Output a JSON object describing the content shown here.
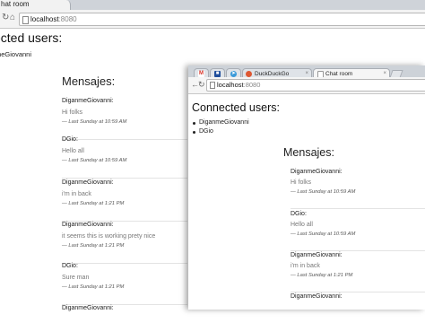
{
  "back_window": {
    "tab_title": "hat room",
    "url_host": "localhost",
    "url_port": ":8080",
    "heading": "ected users:",
    "users": [
      "meGiovanni"
    ],
    "chat_title": "Mensajes:",
    "messages": [
      {
        "author": "DiganmeGiovanni:",
        "text": "Hi folks",
        "time": "— Last Sunday at 10:59 AM"
      },
      {
        "author": "DGio:",
        "text": "Hello all",
        "time": "— Last Sunday at 10:59 AM"
      },
      {
        "author": "DiganmeGiovanni:",
        "text": "i'm in back",
        "time": "— Last Sunday at 1:21 PM"
      },
      {
        "author": "DiganmeGiovanni:",
        "text": "it seems this is working prety nice",
        "time": "— Last Sunday at 1:21 PM"
      },
      {
        "author": "DGio:",
        "text": "Sure man",
        "time": "— Last Sunday at 1:21 PM"
      },
      {
        "author": "DiganmeGiovanni:",
        "text": "",
        "time": ""
      }
    ]
  },
  "front_window": {
    "tabs": [
      {
        "label": "",
        "icon": "gmail-icon",
        "color": "#ffffff",
        "glyph": "M"
      },
      {
        "label": "",
        "icon": "app-icon",
        "color": "#1f4e9c",
        "glyph": "■"
      },
      {
        "label": "",
        "icon": "telegram-icon",
        "color": "#3a9ad9",
        "glyph": "➤"
      },
      {
        "label": "DuckDuckGo",
        "icon": "duckduckgo-icon",
        "color": "#de5833",
        "glyph": "●"
      },
      {
        "label": "Chat room",
        "icon": "page-icon",
        "color": "#ffffff",
        "glyph": ""
      }
    ],
    "close_glyph": "×",
    "url_host": "localhost",
    "url_port": ":8080",
    "heading": "Connected users:",
    "users": [
      "DiganmeGiovanni",
      "DGio"
    ],
    "chat_title": "Mensajes:",
    "messages": [
      {
        "author": "DiganmeGiovanni:",
        "text": "Hi folks",
        "time": "— Last Sunday at 10:59 AM"
      },
      {
        "author": "DGio:",
        "text": "Hello all",
        "time": "— Last Sunday at 10:59 AM"
      },
      {
        "author": "DiganmeGiovanni:",
        "text": "i'm in back",
        "time": "— Last Sunday at 1:21 PM"
      },
      {
        "author": "DiganmeGiovanni:",
        "text": "",
        "time": ""
      }
    ]
  },
  "icons": {
    "back": "←",
    "home": "⌂"
  }
}
